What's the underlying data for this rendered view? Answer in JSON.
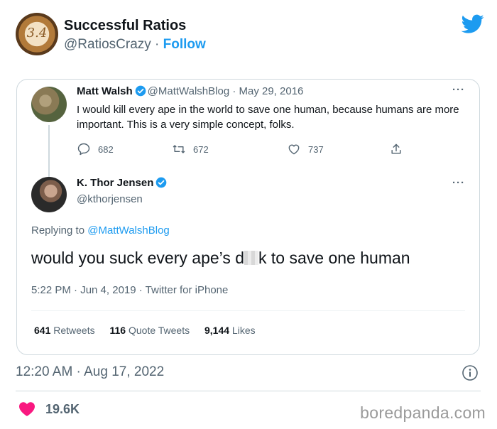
{
  "outer": {
    "name": "Successful Ratios",
    "handle": "@RatiosCrazy",
    "separator": " · ",
    "follow": "Follow",
    "avatar_text": "3.4",
    "timestamp": "12:20 AM · Aug 17, 2022",
    "likes": "19.6K"
  },
  "quoted": {
    "original": {
      "name": "Matt Walsh",
      "handle_date": "@MattWalshBlog · May 29, 2016",
      "text": "I would kill every ape in the world to save one human, because humans are more important. This is a very simple concept, folks.",
      "replies": "682",
      "retweets": "672",
      "likes": "737",
      "more": "···"
    },
    "reply": {
      "name": "K. Thor Jensen",
      "handle": "@kthorjensen",
      "replying_prefix": "Replying to ",
      "replying_to": "@MattWalshBlog",
      "text_before": "would you suck every ape’s d",
      "text_after": "k to save one human",
      "meta": "5:22 PM · Jun 4, 2019 · Twitter for iPhone",
      "more": "···",
      "stats": [
        {
          "value": "641",
          "label": " Retweets"
        },
        {
          "value": "116",
          "label": " Quote Tweets"
        },
        {
          "value": "9,144",
          "label": " Likes"
        }
      ]
    }
  },
  "watermark": "boredpanda.com",
  "colors": {
    "accent": "#1d9bf0",
    "heart": "#f91880",
    "muted": "#536471"
  }
}
